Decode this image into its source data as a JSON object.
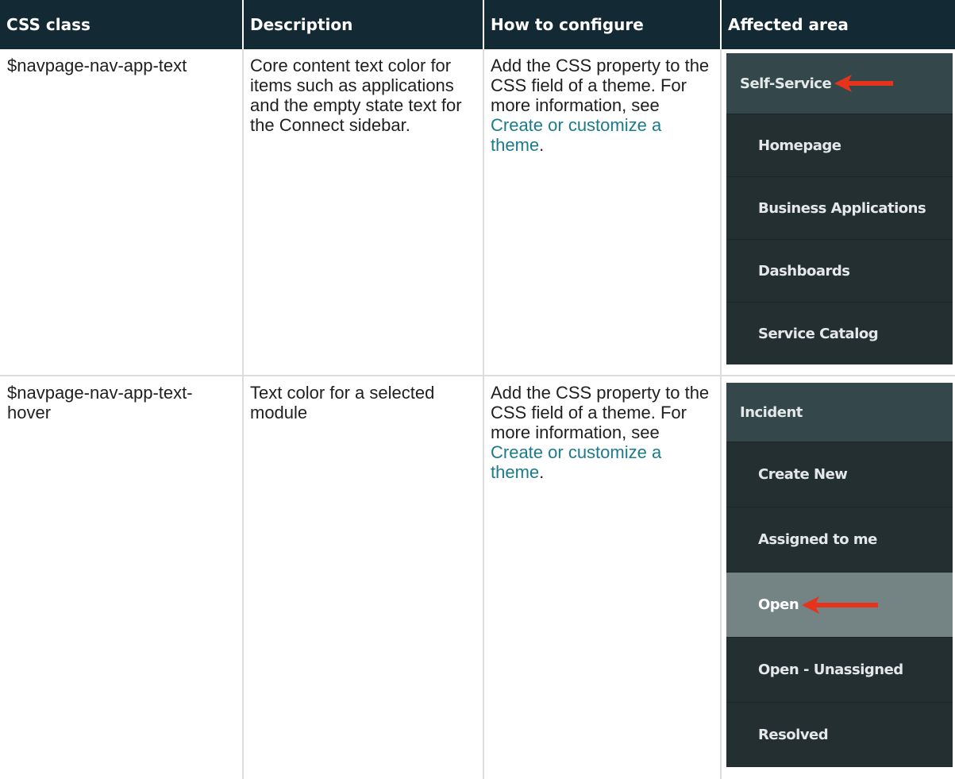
{
  "table": {
    "headers": [
      "CSS class",
      "Description",
      "How to configure",
      "Affected area"
    ],
    "rows": [
      {
        "css_class": "$navpage-nav-app-text",
        "description": "Core content text color for items such as applications and the empty state text for the Connect sidebar.",
        "how_prefix": "Add the CSS property to the CSS field of a theme. For more information, see ",
        "how_link": "Create or customize a theme",
        "how_suffix": ".",
        "nav": {
          "header": "Self-Service",
          "items": [
            "Homepage",
            "Business Applications",
            "Dashboards",
            "Service Catalog"
          ]
        }
      },
      {
        "css_class": "$navpage-nav-app-text-hover",
        "description": "Text color for a selected module",
        "how_prefix": "Add the CSS property to the CSS field of a theme. For more information, see ",
        "how_link": "Create or customize a theme",
        "how_suffix": ".",
        "nav": {
          "header": "Incident",
          "items": [
            "Create New",
            "Assigned to me",
            "Open",
            "Open - Unassigned",
            "Resolved"
          ],
          "selected": "Open"
        }
      }
    ]
  },
  "colors": {
    "header_bg": "#132a35",
    "link": "#1b7b8c",
    "nav_bg": "#242f32",
    "nav_header_bg": "#34474b",
    "nav_selected_bg": "#748484",
    "arrow": "#e8331c"
  },
  "icons": {
    "annotation_arrow": "red-left-arrow-icon"
  }
}
